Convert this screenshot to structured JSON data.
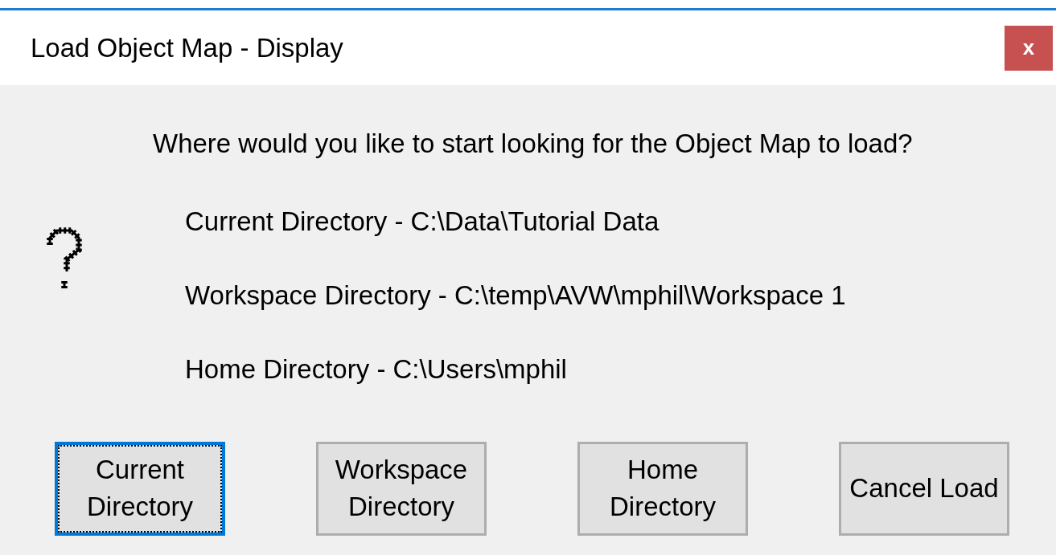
{
  "window": {
    "title": "Load Object Map - Display",
    "close": "x"
  },
  "question": "Where would you like to start looking for the Object Map to load?",
  "options": [
    "Current Directory - C:\\Data\\Tutorial Data",
    "Workspace Directory - C:\\temp\\AVW\\mphil\\Workspace 1",
    "Home Directory - C:\\Users\\mphil"
  ],
  "buttons": [
    {
      "label": "Current Directory",
      "focused": true
    },
    {
      "label": "Workspace Directory",
      "focused": false
    },
    {
      "label": "Home Directory",
      "focused": false
    },
    {
      "label": "Cancel Load",
      "focused": false
    }
  ]
}
